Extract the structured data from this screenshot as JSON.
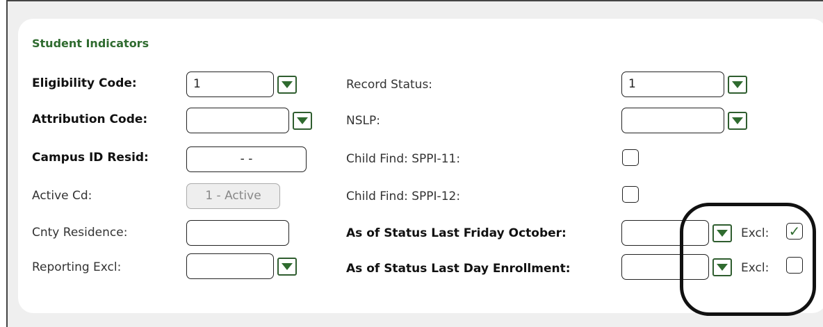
{
  "section": {
    "title": "Student Indicators"
  },
  "left": {
    "eligibility_code": {
      "label": "Eligibility Code:",
      "value": "1"
    },
    "attribution_code": {
      "label": "Attribution Code:",
      "value": ""
    },
    "campus_id_resid": {
      "label": "Campus ID Resid:",
      "value": "- -"
    },
    "active_cd": {
      "label": "Active Cd:",
      "value": "1 - Active"
    },
    "cnty_residence": {
      "label": "Cnty Residence:",
      "value": ""
    },
    "reporting_excl": {
      "label": "Reporting Excl:",
      "value": ""
    }
  },
  "right": {
    "record_status": {
      "label": "Record Status:",
      "value": "1"
    },
    "nslp": {
      "label": "NSLP:",
      "value": ""
    },
    "child_find_11": {
      "label": "Child Find: SPPI-11:",
      "checked": false
    },
    "child_find_12": {
      "label": "Child Find: SPPI-12:",
      "checked": false
    },
    "status_last_friday_october": {
      "label": "As of Status Last Friday October:",
      "value": "",
      "excl_label": "Excl:",
      "excl_checked": true,
      "excl_mark": "✓"
    },
    "status_last_day_enrollment": {
      "label": "As of Status Last Day Enrollment:",
      "value": "",
      "excl_label": "Excl:",
      "excl_checked": false,
      "excl_mark": ""
    }
  },
  "colors": {
    "accent": "#2f6b2f",
    "annotation": "#111111"
  }
}
